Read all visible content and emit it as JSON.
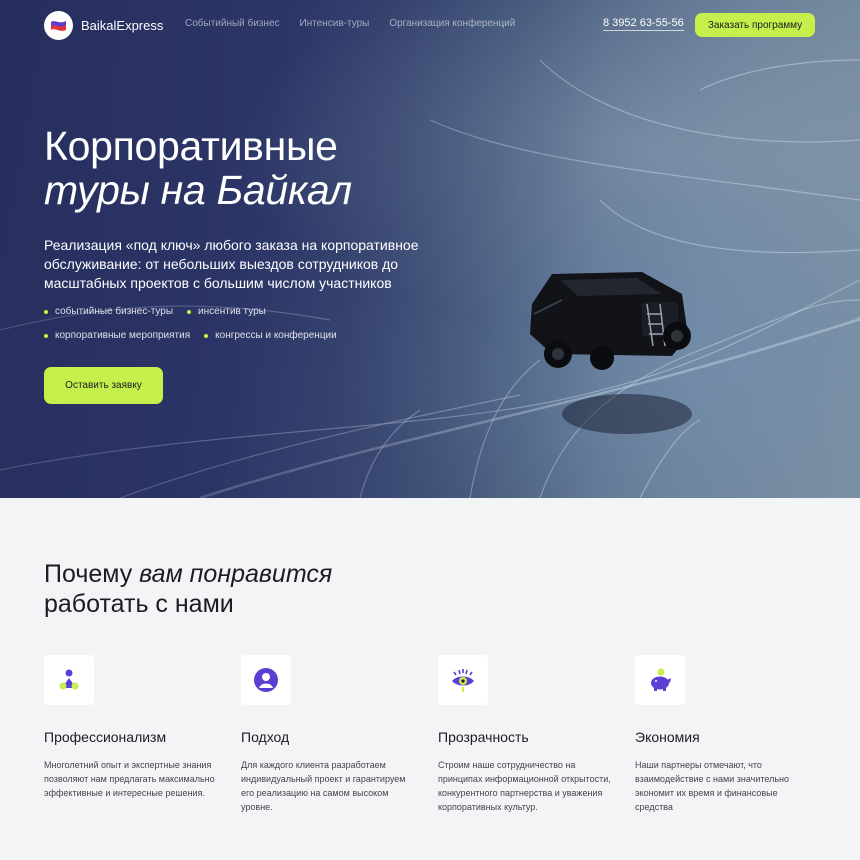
{
  "nav": {
    "logo_text": "BaikalExpress",
    "links": [
      "Событийный бизнес",
      "Интенсив-туры",
      "Организация конференций"
    ],
    "phone": "8 3952 63-55-56",
    "cta_label": "Заказать программу"
  },
  "hero": {
    "title_line1": "Корпоративные",
    "title_line2": "туры на Байкал",
    "lead": "Реализация «под ключ» любого заказа на корпоративное обслуживание: от небольших выездов сотрудников до масштабных проектов с большим числом участников",
    "bullets": [
      "событийные бизнес-туры",
      "инсентив туры",
      "корпоративные мероприятия",
      "конгрессы и конференции"
    ],
    "cta_label": "Оставить заявку"
  },
  "why": {
    "title_pre": "Почему ",
    "title_italic": "вам понравится",
    "title_line2": "работать с нами",
    "features": [
      {
        "icon": "professionals-icon",
        "title": "Профессионализм",
        "text": "Многолетний опыт и экспертные знания позволяют нам предлагать максимально эффективные и интересные решения."
      },
      {
        "icon": "person-circle-icon",
        "title": "Подход",
        "text": "Для каждого клиента разработаем индивидуальный проект и гарантируем его реализацию на самом высоком уровне."
      },
      {
        "icon": "eye-icon",
        "title": "Прозрачность",
        "text": "Строим наше сотрудничество на принципах информационной открытости, конкурентного партнерства и уважения корпоративных культур."
      },
      {
        "icon": "piggy-bank-icon",
        "title": "Экономия",
        "text": "Наши партнеры отмечают, что взаимодействие с нами значительно экономит их время и финансовые средства"
      }
    ]
  },
  "colors": {
    "accent": "#c5ef4a",
    "icon_purple": "#5b3fd4",
    "hero_bg": "#2f3a6a",
    "section_bg": "#f3f4f6"
  }
}
